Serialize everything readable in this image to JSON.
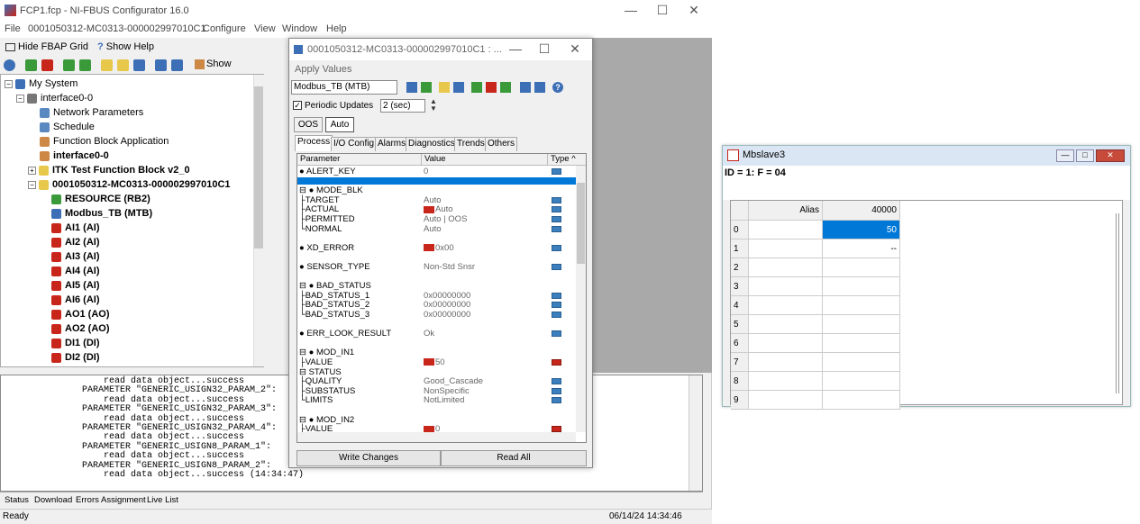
{
  "main": {
    "title": "FCP1.fcp - NI-FBUS Configurator 16.0",
    "menu": [
      "File",
      "0001050312-MC0313-000002997010C1",
      "Configure",
      "View",
      "Window",
      "Help"
    ],
    "toolbar": {
      "hide_fbap": "Hide FBAP Grid",
      "show_help": "Show Help",
      "show": "Show"
    },
    "tree": [
      {
        "label": "My System",
        "indent": 0,
        "box": "⊟",
        "bold": false,
        "color": "#3c6fb5"
      },
      {
        "label": "interface0-0",
        "indent": 1,
        "box": "⊟",
        "bold": false,
        "color": "#777"
      },
      {
        "label": "Network Parameters",
        "indent": 3,
        "box": "",
        "bold": false,
        "color": "#5a88c0"
      },
      {
        "label": "Schedule",
        "indent": 3,
        "box": "",
        "bold": false,
        "color": "#5a88c0"
      },
      {
        "label": "Function Block Application",
        "indent": 3,
        "box": "",
        "bold": false,
        "color": "#c84"
      },
      {
        "label": "interface0-0",
        "indent": 3,
        "box": "",
        "bold": true,
        "color": "#c84"
      },
      {
        "label": "ITK Test Function Block v2_0",
        "indent": 2,
        "box": "⊞",
        "bold": true,
        "color": "#e8c84a"
      },
      {
        "label": "0001050312-MC0313-000002997010C1",
        "indent": 2,
        "box": "⊟",
        "bold": true,
        "color": "#e8c84a"
      },
      {
        "label": "RESOURCE (RB2)",
        "indent": 4,
        "box": "",
        "bold": true,
        "color": "#3a9a3a"
      },
      {
        "label": "Modbus_TB (MTB)",
        "indent": 4,
        "box": "",
        "bold": true,
        "color": "#3c6fb5"
      },
      {
        "label": "AI1 (AI)",
        "indent": 4,
        "box": "",
        "bold": true,
        "color": "#c8261b"
      },
      {
        "label": "AI2 (AI)",
        "indent": 4,
        "box": "",
        "bold": true,
        "color": "#c8261b"
      },
      {
        "label": "AI3 (AI)",
        "indent": 4,
        "box": "",
        "bold": true,
        "color": "#c8261b"
      },
      {
        "label": "AI4 (AI)",
        "indent": 4,
        "box": "",
        "bold": true,
        "color": "#c8261b"
      },
      {
        "label": "AI5 (AI)",
        "indent": 4,
        "box": "",
        "bold": true,
        "color": "#c8261b"
      },
      {
        "label": "AI6 (AI)",
        "indent": 4,
        "box": "",
        "bold": true,
        "color": "#c8261b"
      },
      {
        "label": "AO1 (AO)",
        "indent": 4,
        "box": "",
        "bold": true,
        "color": "#c8261b"
      },
      {
        "label": "AO2 (AO)",
        "indent": 4,
        "box": "",
        "bold": true,
        "color": "#c8261b"
      },
      {
        "label": "DI1 (DI)",
        "indent": 4,
        "box": "",
        "bold": true,
        "color": "#c8261b"
      },
      {
        "label": "DI2 (DI)",
        "indent": 4,
        "box": "",
        "bold": true,
        "color": "#c8261b"
      }
    ],
    "log": "    read data object...success\nPARAMETER \"GENERIC_USIGN32_PARAM_2\":\n    read data object...success\nPARAMETER \"GENERIC_USIGN32_PARAM_3\":\n    read data object...success\nPARAMETER \"GENERIC_USIGN32_PARAM_4\":\n    read data object...success\nPARAMETER \"GENERIC_USIGN8_PARAM_1\":\n    read data object...success\nPARAMETER \"GENERIC_USIGN8_PARAM_2\":\n    read data object...success (14:34:47)",
    "log_tabs": [
      "Status",
      "Download",
      "Errors",
      "Assignment",
      "Live List"
    ],
    "status_left": "Ready",
    "status_right": "06/14/24 14:34:46"
  },
  "dialog": {
    "title": "0001050312-MC0313-000002997010C1 : ...",
    "apply_values": "Apply Values",
    "block_select": "Modbus_TB (MTB)",
    "periodic": "Periodic Updates",
    "interval": "2 (sec)",
    "mode_oos": "OOS",
    "mode_auto": "Auto",
    "tabs": [
      "Process",
      "I/O Config",
      "Alarms",
      "Diagnostics",
      "Trends",
      "Others"
    ],
    "col_param": "Parameter",
    "col_value": "Value",
    "col_type": "Type",
    "write_changes": "Write Changes",
    "read_all": "Read All",
    "rows": [
      {
        "p": "● ALERT_KEY",
        "v": "0",
        "y": 0,
        "t": "blue"
      },
      {
        "p": "⊟ ● MODE_BLK",
        "v": "",
        "y": 2,
        "t": ""
      },
      {
        "p": "   ├TARGET",
        "v": "Auto",
        "y": 3,
        "t": "blue"
      },
      {
        "p": "   ├ACTUAL",
        "v": "Auto",
        "y": 4,
        "t": "blue",
        "mark": true
      },
      {
        "p": "   ├PERMITTED",
        "v": "Auto | OOS",
        "y": 5,
        "t": "blue"
      },
      {
        "p": "   └NORMAL",
        "v": "Auto",
        "y": 6,
        "t": "blue"
      },
      {
        "p": "● XD_ERROR",
        "v": "0x00",
        "y": 8,
        "t": "blue",
        "mark": true
      },
      {
        "p": "● SENSOR_TYPE",
        "v": "Non-Std Snsr",
        "y": 10,
        "t": "blue"
      },
      {
        "p": "⊟ ● BAD_STATUS",
        "v": "",
        "y": 12,
        "t": ""
      },
      {
        "p": "   ├BAD_STATUS_1",
        "v": "0x00000000",
        "y": 13,
        "t": "blue"
      },
      {
        "p": "   ├BAD_STATUS_2",
        "v": "0x00000000",
        "y": 14,
        "t": "blue"
      },
      {
        "p": "   └BAD_STATUS_3",
        "v": "0x00000000",
        "y": 15,
        "t": "blue"
      },
      {
        "p": "● ERR_LOOK_RESULT",
        "v": "Ok",
        "y": 17,
        "t": "blue"
      },
      {
        "p": "⊟ ● MOD_IN1",
        "v": "",
        "y": 19,
        "t": ""
      },
      {
        "p": "   ├VALUE",
        "v": "50",
        "y": 20,
        "t": "red",
        "mark": true
      },
      {
        "p": "   ⊟ STATUS",
        "v": "",
        "y": 21,
        "t": ""
      },
      {
        "p": "      ├QUALITY",
        "v": "Good_Cascade",
        "y": 22,
        "t": "blue"
      },
      {
        "p": "      ├SUBSTATUS",
        "v": "NonSpecific",
        "y": 23,
        "t": "blue"
      },
      {
        "p": "      └LIMITS",
        "v": "NotLimited",
        "y": 24,
        "t": "blue"
      },
      {
        "p": "⊟ ● MOD_IN2",
        "v": "",
        "y": 26,
        "t": ""
      },
      {
        "p": "   ├VALUE",
        "v": "0",
        "y": 27,
        "t": "red",
        "mark": true
      }
    ]
  },
  "mbslave": {
    "title": "Mbslave3",
    "id_line": "ID = 1: F = 04",
    "col_alias": "Alias",
    "col_addr": "40000",
    "rows": [
      {
        "n": "0",
        "v": "50",
        "sel": true
      },
      {
        "n": "1",
        "v": "--",
        "sel": false
      },
      {
        "n": "2",
        "v": "",
        "sel": false
      },
      {
        "n": "3",
        "v": "",
        "sel": false
      },
      {
        "n": "4",
        "v": "",
        "sel": false
      },
      {
        "n": "5",
        "v": "",
        "sel": false
      },
      {
        "n": "6",
        "v": "",
        "sel": false
      },
      {
        "n": "7",
        "v": "",
        "sel": false
      },
      {
        "n": "8",
        "v": "",
        "sel": false
      },
      {
        "n": "9",
        "v": "",
        "sel": false
      }
    ],
    "selection_color": "#0078d7"
  }
}
